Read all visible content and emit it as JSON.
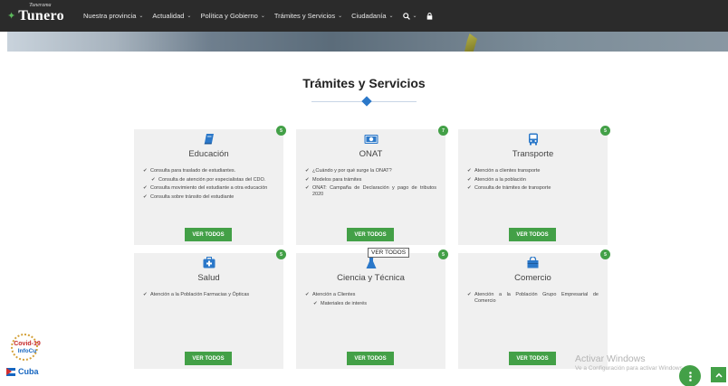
{
  "navbar": {
    "brand_small": "Tunerama",
    "brand_main": "Tunero",
    "items": [
      {
        "label": "Nuestra provincia"
      },
      {
        "label": "Actualidad"
      },
      {
        "label": "Política y Gobierno"
      },
      {
        "label": "Trámites y Servicios"
      },
      {
        "label": "Ciudadanía"
      }
    ],
    "search_icon": "search-icon",
    "lock_icon": "lock-icon"
  },
  "section": {
    "title": "Trámites y Servicios"
  },
  "cards": [
    {
      "title": "Educación",
      "icon": "book-icon",
      "badge": "5",
      "items": [
        {
          "text": "Consulta para traslado de estudiantes.",
          "sub": false
        },
        {
          "text": "Consulta de atención por especialistas del CDO.",
          "sub": true
        },
        {
          "text": "Consulta movimiento del estudiante a otra educación",
          "sub": false
        },
        {
          "text": "Consulta sobre tránsito del estudiante",
          "sub": false
        }
      ],
      "button": "VER TODOS"
    },
    {
      "title": "ONAT",
      "icon": "money-icon",
      "badge": "7",
      "items": [
        {
          "text": "¿Cuándo y por qué surge la ONAT?",
          "sub": false
        },
        {
          "text": "Modelos para trámites",
          "sub": false
        },
        {
          "text": "ONAT: Campaña de Declaración y pago de tributos 2020",
          "sub": false
        }
      ],
      "button": "VER TODOS"
    },
    {
      "title": "Transporte",
      "icon": "bus-icon",
      "badge": "5",
      "items": [
        {
          "text": "Atención a clientes transporte",
          "sub": false
        },
        {
          "text": "Atención a la población",
          "sub": false
        },
        {
          "text": "Consulta de trámites de transporte",
          "sub": false
        }
      ],
      "button": "VER TODOS"
    },
    {
      "title": "Salud",
      "icon": "medkit-icon",
      "badge": "5",
      "items": [
        {
          "text": "Atención a la Población Farmacias y Ópticas",
          "sub": false
        }
      ],
      "button": "VER TODOS"
    },
    {
      "title": "Ciencia y Técnica",
      "icon": "flask-icon",
      "badge": "5",
      "items": [
        {
          "text": "Atención a Clientes",
          "sub": false
        },
        {
          "text": "Materiales de interés",
          "sub": true
        }
      ],
      "button": "VER TODOS"
    },
    {
      "title": "Comercio",
      "icon": "shopping-bag-icon",
      "badge": "5",
      "items": [
        {
          "text": "Atención a la Población Grupo Empresarial de Comercio",
          "sub": false
        }
      ],
      "button": "VER TODOS"
    }
  ],
  "tooltip": "VER TODOS",
  "covid": {
    "top": "Covid-19",
    "bottom": "InfoCu"
  },
  "cuba": {
    "label": "Cuba"
  },
  "activate": {
    "title": "Activar Windows",
    "subtitle": "Ve a Configuración para activar Windows."
  },
  "colors": {
    "accent_green": "#43a047",
    "accent_blue": "#2b78c9",
    "navbar": "#2b2b2b"
  }
}
